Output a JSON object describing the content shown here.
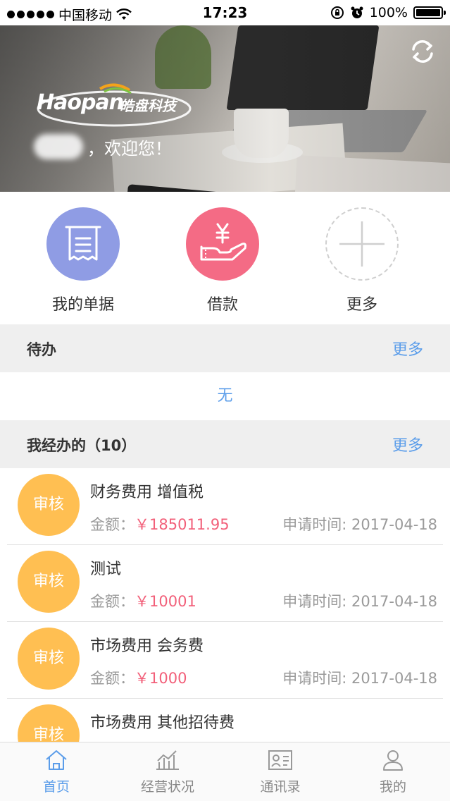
{
  "status_bar": {
    "carrier": "中国移动",
    "time": "17:23",
    "battery": "100%"
  },
  "banner": {
    "logo_text": "Haopan",
    "logo_cn": "皓盘科技",
    "welcome": "，欢迎您！"
  },
  "quick_actions": [
    {
      "label": "我的单据",
      "icon": "receipt-icon",
      "color": "#8f9ce4"
    },
    {
      "label": "借款",
      "icon": "yuan-hand-icon",
      "color": "#f46b85"
    },
    {
      "label": "更多",
      "icon": "plus-icon"
    }
  ],
  "todo": {
    "title": "待办",
    "more": "更多",
    "empty": "无"
  },
  "handled": {
    "title": "我经办的（10）",
    "more": "更多",
    "items": [
      {
        "badge": "审核",
        "name": "财务费用 增值税",
        "amount_label": "金额：",
        "amount": "￥185011.95",
        "date": "申请时间: 2017-04-18"
      },
      {
        "badge": "审核",
        "name": "测试",
        "amount_label": "金额：",
        "amount": "￥10001",
        "date": "申请时间: 2017-04-18"
      },
      {
        "badge": "审核",
        "name": "市场费用 会务费",
        "amount_label": "金额：",
        "amount": "￥1000",
        "date": "申请时间: 2017-04-18"
      },
      {
        "badge": "审核",
        "name": "市场费用 其他招待费",
        "amount_label": "",
        "amount": "",
        "date": ""
      }
    ]
  },
  "tabbar": {
    "tabs": [
      {
        "label": "首页",
        "icon": "home-icon",
        "active": true
      },
      {
        "label": "经营状况",
        "icon": "chart-icon",
        "active": false
      },
      {
        "label": "通讯录",
        "icon": "contacts-icon",
        "active": false
      },
      {
        "label": "我的",
        "icon": "user-icon",
        "active": false
      }
    ]
  },
  "colors": {
    "accent": "#5b9dea",
    "badge": "#ffbf52",
    "amount": "#f2607a"
  }
}
